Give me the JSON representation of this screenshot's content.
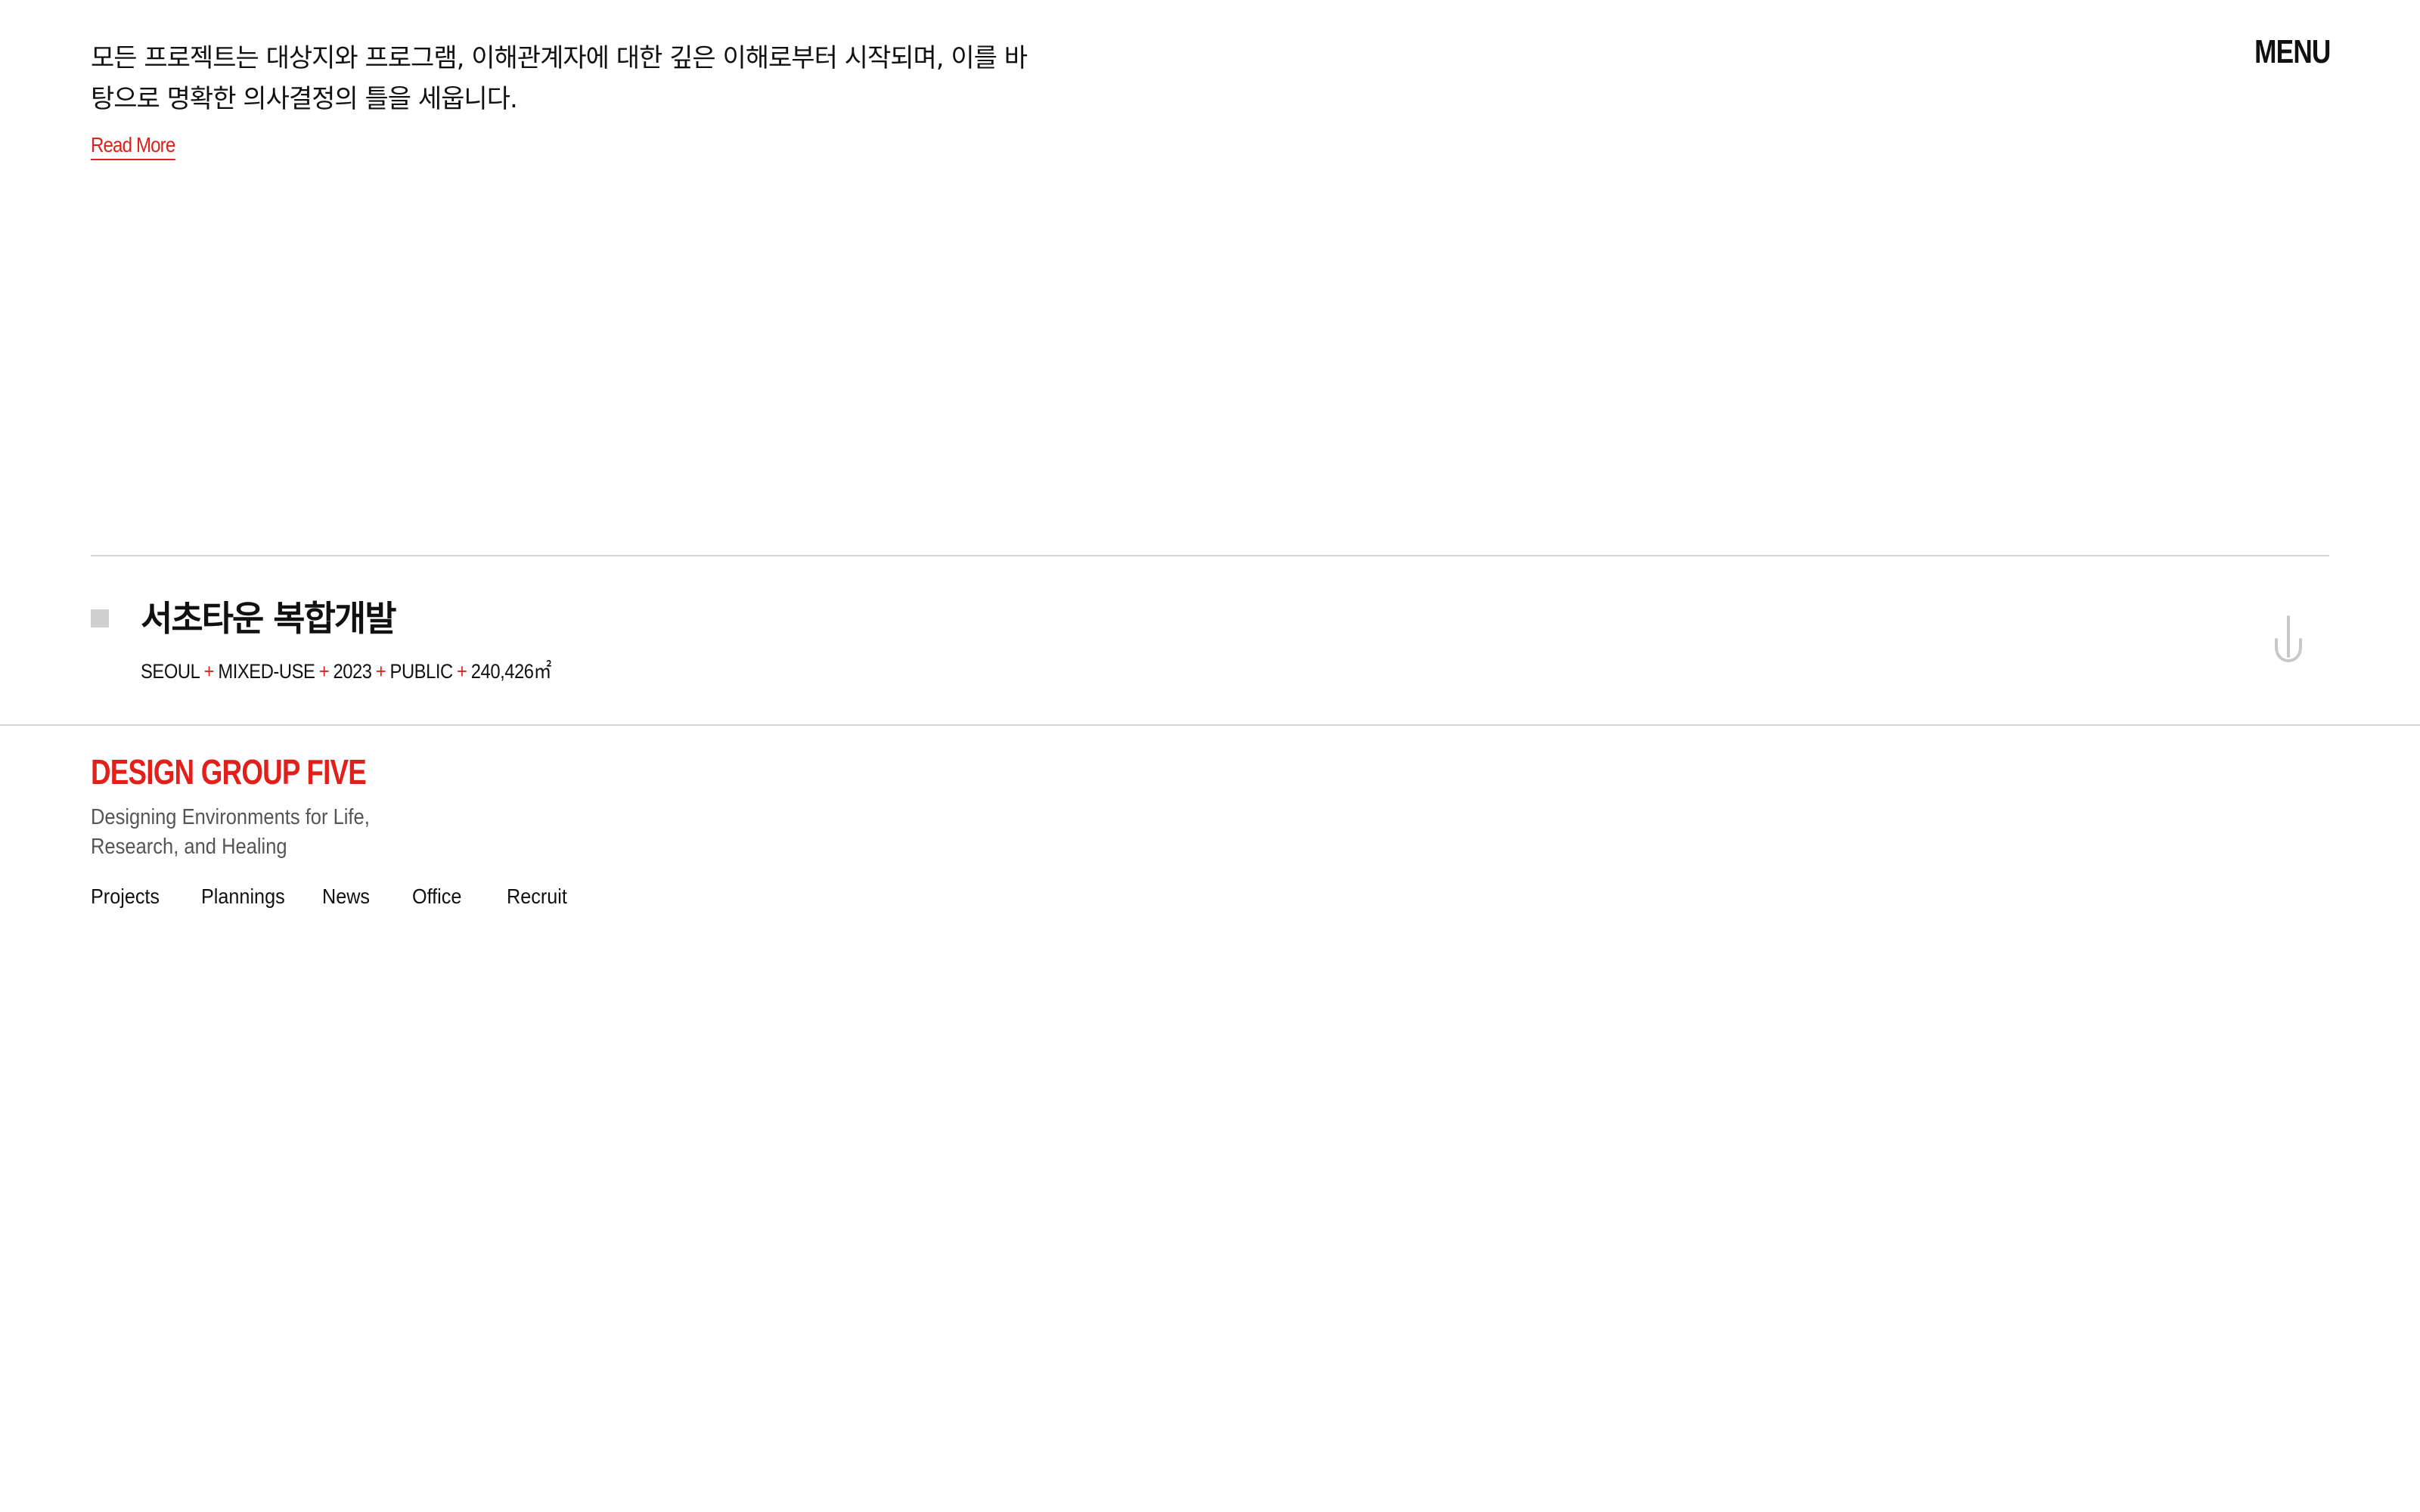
{
  "header": {
    "menu_label": "MENU"
  },
  "intro": {
    "text": "모든 프로젝트는 대상지와 프로그램, 이해관계자에 대한 깊은 이해로부터 시작되며, 이를 바탕으로 명확한 의사결정의 틀을 세웁니다.",
    "read_more_label": "Read More"
  },
  "project": {
    "title": "서초타운 복합개발",
    "meta": [
      "SEOUL",
      "MIXED-USE",
      "2023",
      "PUBLIC",
      "240,426㎡"
    ],
    "separator": "+"
  },
  "footer": {
    "brand": "DESIGN GROUP FIVE",
    "tagline_line1": "Designing Environments for Life,",
    "tagline_line2": "Research, and Healing",
    "nav": [
      "Projects",
      "Plannings",
      "News",
      "Office",
      "Recruit"
    ]
  },
  "colors": {
    "accent": "#e0201b",
    "divider": "#d4d4d4",
    "marker": "#cfcfcf",
    "icon": "#c8c8c8"
  },
  "icons": {
    "scroll": "pointing-down-arrow-icon",
    "marker": "square-marker-icon"
  }
}
